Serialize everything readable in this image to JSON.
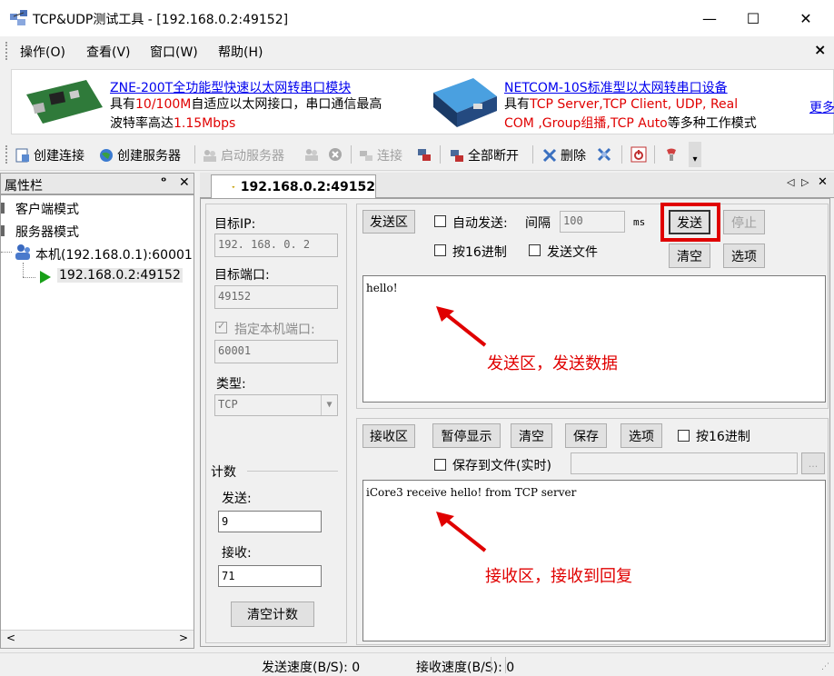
{
  "window": {
    "title": "TCP&UDP测试工具 - [192.168.0.2:49152]",
    "minimize": "—",
    "maximize": "☐",
    "close": "✕"
  },
  "menu": {
    "items": [
      "操作(O)",
      "查看(V)",
      "窗口(W)",
      "帮助(H)"
    ],
    "close": "×"
  },
  "banner": {
    "ad1_title": "ZNE-200T全功能型快速以太网转串口模块",
    "ad1_line1_a": "具有",
    "ad1_line1_b": "10/100M",
    "ad1_line1_c": "自适应以太网接口，串口通信最高",
    "ad1_line2_a": "波特率高达",
    "ad1_line2_b": "1.15Mbps",
    "ad2_title": "NETCOM-10S标准型以太网转串口设备",
    "ad2_line1_a": "具有",
    "ad2_line1_b": "TCP Server,TCP Client, UDP, Real",
    "ad2_line2_a": "COM ,Group组播,TCP Auto",
    "ad2_line2_b": "等多种工作模式",
    "more": "更多"
  },
  "toolbar": {
    "create_conn": "创建连接",
    "create_server": "创建服务器",
    "start_server": "启动服务器",
    "connect": "连接",
    "disconnect_all": "全部断开",
    "delete": "删除"
  },
  "sidebar": {
    "title": "属性栏",
    "pin": "ᵠ",
    "close": "✕",
    "items": [
      "客户端模式",
      "服务器模式",
      "本机(192.168.0.1):60001",
      "192.168.0.2:49152"
    ]
  },
  "tab": {
    "label": "192.168.0.2:49152",
    "nav_left": "◁",
    "nav_right": "▷",
    "close": "✕"
  },
  "left_form": {
    "target_ip_label": "目标IP:",
    "target_ip": "192. 168. 0. 2",
    "target_port_label": "目标端口:",
    "target_port": "49152",
    "local_port_label": "指定本机端口:",
    "local_port": "60001",
    "type_label": "类型:",
    "type": "TCP",
    "count_label": "计数",
    "sent_label": "发送:",
    "sent": "9",
    "recv_label": "接收:",
    "recv": "71",
    "clear_count": "清空计数"
  },
  "send": {
    "area_label": "发送区",
    "auto_send": "自动发送:",
    "interval_label": "间隔",
    "interval": "100",
    "unit": "ms",
    "send_btn": "发送",
    "stop_btn": "停止",
    "hex": "按16进制",
    "send_file": "发送文件",
    "clear": "清空",
    "options": "选项",
    "content": "hello!",
    "note": "发送区，发送数据"
  },
  "recv": {
    "area_label": "接收区",
    "pause": "暂停显示",
    "clear": "清空",
    "save": "保存",
    "options": "选项",
    "hex": "按16进制",
    "save_file": "保存到文件(实时)",
    "browse": "...",
    "content": "iCore3 receive hello! from TCP server",
    "note": "接收区，接收到回复"
  },
  "status": {
    "send_speed": "发送速度(B/S): 0",
    "recv_speed": "接收速度(B/S): 0"
  },
  "colors": {
    "highlight": "#e00000",
    "link": "#0000ee"
  }
}
